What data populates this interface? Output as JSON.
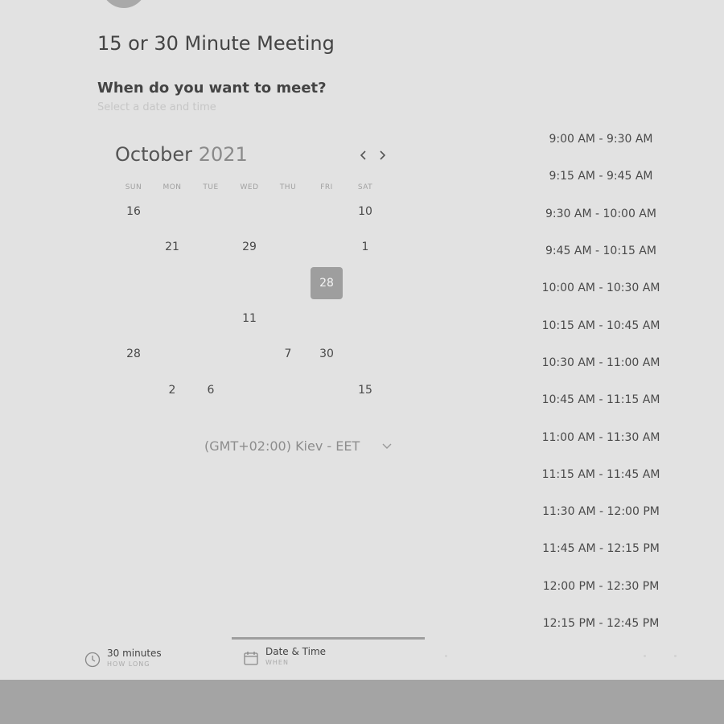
{
  "meeting": {
    "title": "15 or 30 Minute Meeting",
    "question": "When do you want to meet?",
    "subtitle": "Select a date and time"
  },
  "calendar": {
    "month": "October",
    "year": "2021",
    "weekdays": [
      "SUN",
      "MON",
      "TUE",
      "WED",
      "THU",
      "FRI",
      "SAT"
    ],
    "rows": [
      [
        "16",
        "",
        "",
        "",
        "",
        "",
        "10"
      ],
      [
        "",
        "21",
        "",
        "29",
        "",
        "",
        "1"
      ],
      [
        "",
        "",
        "",
        "",
        "",
        "28",
        ""
      ],
      [
        "",
        "",
        "",
        "11",
        "",
        "",
        ""
      ],
      [
        "28",
        "",
        "",
        "",
        "7",
        "30",
        ""
      ],
      [
        "",
        "2",
        "6",
        "",
        "",
        "",
        "15"
      ]
    ],
    "selected": "28",
    "timezone": "(GMT+02:00) Kiev - EET"
  },
  "time_slots": [
    "9:00 AM - 9:30 AM",
    "9:15 AM - 9:45 AM",
    "9:30 AM - 10:00 AM",
    "9:45 AM - 10:15 AM",
    "10:00 AM - 10:30 AM",
    "10:15 AM - 10:45 AM",
    "10:30 AM - 11:00 AM",
    "10:45 AM - 11:15 AM",
    "11:00 AM - 11:30 AM",
    "11:15 AM - 11:45 AM",
    "11:30 AM - 12:00 PM",
    "11:45 AM - 12:15 PM",
    "12:00 PM - 12:30 PM",
    "12:15 PM - 12:45 PM"
  ],
  "steps": {
    "duration_label": "30 minutes",
    "duration_sub": "HOW LONG",
    "datetime_label": "Date & Time",
    "datetime_sub": "WHEN"
  },
  "icons": {
    "duration": "clock-icon",
    "datetime": "calendar-icon",
    "prev": "chevron-left-icon",
    "next": "chevron-right-icon",
    "timezone": "chevron-down-icon"
  },
  "colors": {
    "background": "#e2e2e2",
    "selected_day": "#9e9e9e",
    "footer": "#a4a4a4"
  }
}
